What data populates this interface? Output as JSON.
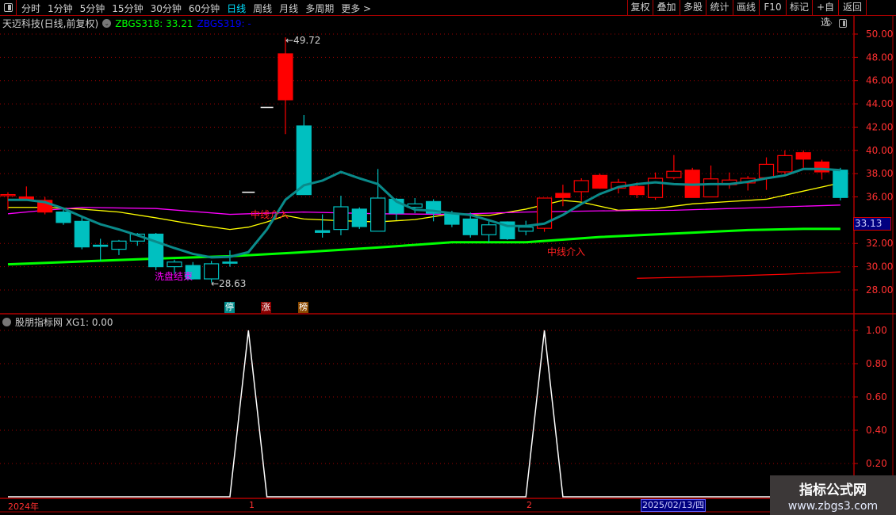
{
  "toolbar": {
    "left_items": [
      "分时",
      "1分钟",
      "5分钟",
      "15分钟",
      "30分钟",
      "60分钟",
      "日线",
      "周线",
      "月线",
      "多周期",
      "更多 >"
    ],
    "active_item": "日线",
    "right_items": [
      "复权",
      "叠加",
      "多股",
      "统计",
      "画线",
      "F10",
      "标记",
      "+自选",
      "返回"
    ]
  },
  "legend": {
    "stock_name": "天迈科技(日线,前复权)",
    "series1": "ZBGS318: 33.21",
    "series2": "ZBGS319: -"
  },
  "sub_legend": {
    "text": "股朋指标网  XG1: 0.00"
  },
  "current_price_tag": "33.13",
  "cursor_date": "2025/02/13/四",
  "annotations": {
    "high_label": "←49.72",
    "low_label": "←28.63",
    "mid_entry_1": "中线介入",
    "mid_entry_2": "中线介入",
    "washout_end": "洗盘结束"
  },
  "badges": [
    {
      "text": "停",
      "color": "#008c8c"
    },
    {
      "text": "涨",
      "color": "#8c0000"
    },
    {
      "text": "榜",
      "color": "#8c4a00"
    }
  ],
  "watermark": {
    "title": "指标公式网",
    "url": "www.zbgs3.com"
  },
  "colors": {
    "up": "#ff0000",
    "down": "#00c0c0",
    "axis": "#ff3030",
    "grid": "#b00000"
  },
  "chart_data": [
    {
      "type": "candlestick",
      "title": "天迈科技(日线,前复权)",
      "ylim": [
        27,
        50.5
      ],
      "y_ticks": [
        "50.00",
        "48.00",
        "46.00",
        "44.00",
        "42.00",
        "40.00",
        "38.00",
        "36.00",
        "32.00",
        "30.00",
        "28.00"
      ],
      "x_labels": [
        "2024年",
        "1",
        "2"
      ],
      "grid": true,
      "candles": [
        {
          "o": 36.2,
          "h": 36.4,
          "l": 34.9,
          "c": 36.2,
          "style": "red-hollow"
        },
        {
          "o": 36.0,
          "h": 36.9,
          "l": 35.9,
          "c": 35.8,
          "style": "red-solid"
        },
        {
          "o": 35.7,
          "h": 36.0,
          "l": 34.5,
          "c": 34.7,
          "style": "red-solid"
        },
        {
          "o": 34.7,
          "h": 34.9,
          "l": 33.6,
          "c": 33.8,
          "style": "cyan-solid"
        },
        {
          "o": 33.9,
          "h": 34.2,
          "l": 31.5,
          "c": 31.7,
          "style": "cyan-solid"
        },
        {
          "o": 31.85,
          "h": 32.4,
          "l": 30.5,
          "c": 31.75,
          "style": "cyan-solid"
        },
        {
          "o": 31.5,
          "h": 32.3,
          "l": 31.0,
          "c": 32.2,
          "style": "cyan-hollow"
        },
        {
          "o": 32.2,
          "h": 32.9,
          "l": 31.8,
          "c": 32.8,
          "style": "cyan-hollow"
        },
        {
          "o": 32.8,
          "h": 32.9,
          "l": 29.7,
          "c": 30.0,
          "style": "cyan-solid"
        },
        {
          "o": 30.0,
          "h": 30.6,
          "l": 29.4,
          "c": 30.4,
          "style": "cyan-hollow"
        },
        {
          "o": 30.1,
          "h": 30.4,
          "l": 28.9,
          "c": 28.95,
          "style": "cyan-solid"
        },
        {
          "o": 28.95,
          "h": 30.5,
          "l": 28.63,
          "c": 30.25,
          "style": "cyan-hollow"
        },
        {
          "o": 30.4,
          "h": 31.4,
          "l": 30.0,
          "c": 30.3,
          "style": "cyan-solid"
        },
        {
          "o": 36.4,
          "h": 36.4,
          "l": 36.4,
          "c": 36.4,
          "style": "white-dash"
        },
        {
          "o": 43.7,
          "h": 43.7,
          "l": 43.7,
          "c": 43.7,
          "style": "white-dash"
        },
        {
          "o": 48.3,
          "h": 49.72,
          "l": 41.4,
          "c": 44.35,
          "style": "red-solid"
        },
        {
          "o": 42.1,
          "h": 43.05,
          "l": 36.2,
          "c": 36.2,
          "style": "cyan-solid"
        },
        {
          "o": 33.1,
          "h": 34.5,
          "l": 32.5,
          "c": 32.95,
          "style": "cyan-solid"
        },
        {
          "o": 33.2,
          "h": 36.1,
          "l": 32.7,
          "c": 35.15,
          "style": "cyan-hollow"
        },
        {
          "o": 34.95,
          "h": 35.1,
          "l": 33.25,
          "c": 33.45,
          "style": "cyan-solid"
        },
        {
          "o": 33.05,
          "h": 38.4,
          "l": 33.05,
          "c": 35.9,
          "style": "cyan-hollow"
        },
        {
          "o": 35.8,
          "h": 35.9,
          "l": 34.0,
          "c": 34.6,
          "style": "cyan-solid"
        },
        {
          "o": 35.1,
          "h": 35.9,
          "l": 34.6,
          "c": 35.4,
          "style": "cyan-hollow"
        },
        {
          "o": 35.6,
          "h": 35.8,
          "l": 33.9,
          "c": 34.6,
          "style": "cyan-solid"
        },
        {
          "o": 34.6,
          "h": 34.8,
          "l": 33.4,
          "c": 33.65,
          "style": "cyan-solid"
        },
        {
          "o": 34.1,
          "h": 34.65,
          "l": 32.5,
          "c": 32.75,
          "style": "cyan-solid"
        },
        {
          "o": 32.75,
          "h": 33.9,
          "l": 32.1,
          "c": 33.6,
          "style": "cyan-hollow"
        },
        {
          "o": 33.85,
          "h": 33.9,
          "l": 32.3,
          "c": 32.4,
          "style": "cyan-solid"
        },
        {
          "o": 33.05,
          "h": 33.95,
          "l": 32.7,
          "c": 33.4,
          "style": "cyan-hollow"
        },
        {
          "o": 33.3,
          "h": 35.9,
          "l": 33.0,
          "c": 35.9,
          "style": "red-hollow"
        },
        {
          "o": 36.3,
          "h": 37.05,
          "l": 35.2,
          "c": 35.95,
          "style": "red-solid"
        },
        {
          "o": 36.45,
          "h": 37.6,
          "l": 35.65,
          "c": 37.4,
          "style": "red-hollow"
        },
        {
          "o": 37.85,
          "h": 38.0,
          "l": 36.7,
          "c": 36.75,
          "style": "red-solid"
        },
        {
          "o": 36.75,
          "h": 37.55,
          "l": 36.3,
          "c": 37.25,
          "style": "red-hollow"
        },
        {
          "o": 36.9,
          "h": 37.25,
          "l": 35.9,
          "c": 36.2,
          "style": "red-solid"
        },
        {
          "o": 35.95,
          "h": 38.1,
          "l": 35.75,
          "c": 37.6,
          "style": "red-hollow"
        },
        {
          "o": 37.65,
          "h": 39.6,
          "l": 37.5,
          "c": 38.2,
          "style": "red-hollow"
        },
        {
          "o": 38.3,
          "h": 38.5,
          "l": 35.95,
          "c": 35.95,
          "style": "red-solid"
        },
        {
          "o": 36.0,
          "h": 38.7,
          "l": 36.0,
          "c": 37.55,
          "style": "red-hollow"
        },
        {
          "o": 37.05,
          "h": 38.1,
          "l": 36.7,
          "c": 37.45,
          "style": "red-hollow"
        },
        {
          "o": 37.2,
          "h": 37.8,
          "l": 36.55,
          "c": 37.6,
          "style": "red-hollow"
        },
        {
          "o": 37.65,
          "h": 39.4,
          "l": 36.6,
          "c": 38.8,
          "style": "red-hollow"
        },
        {
          "o": 38.15,
          "h": 40.0,
          "l": 37.95,
          "c": 39.55,
          "style": "red-hollow"
        },
        {
          "o": 39.8,
          "h": 40.0,
          "l": 38.5,
          "c": 39.25,
          "style": "red-solid"
        },
        {
          "o": 39.0,
          "h": 39.2,
          "l": 37.5,
          "c": 38.15,
          "style": "red-solid"
        },
        {
          "o": 38.3,
          "h": 38.5,
          "l": 35.7,
          "c": 35.95,
          "style": "cyan-solid"
        }
      ],
      "lines": [
        {
          "color": "#0a8a8a",
          "width": 3,
          "values": [
            35.75,
            35.75,
            35.55,
            35.0,
            34.3,
            33.65,
            33.2,
            32.7,
            32.15,
            31.6,
            31.1,
            30.8,
            30.85,
            31.25,
            33.2,
            35.75,
            37.0,
            37.4,
            38.15,
            37.6,
            37.1,
            35.6,
            34.9,
            34.8,
            34.6,
            34.45,
            34.0,
            33.5,
            33.5,
            33.7,
            34.45,
            35.4,
            36.25,
            36.85,
            37.1,
            37.25,
            37.1,
            37.05,
            37.1,
            37.1,
            37.3,
            37.6,
            37.85,
            38.4,
            38.4,
            38.3
          ]
        },
        {
          "color": "#ffff00",
          "width": 1.3,
          "points": [
            [
              0,
              35.1
            ],
            [
              2,
              35.1
            ],
            [
              4,
              34.95
            ],
            [
              6,
              34.7
            ],
            [
              8,
              34.2
            ],
            [
              10,
              33.65
            ],
            [
              12,
              33.2
            ],
            [
              13,
              33.4
            ],
            [
              14,
              33.85
            ],
            [
              15,
              34.4
            ],
            [
              16,
              34.1
            ],
            [
              18,
              33.95
            ],
            [
              20,
              33.85
            ],
            [
              22,
              34.05
            ],
            [
              24,
              34.55
            ],
            [
              26,
              34.4
            ],
            [
              28,
              34.95
            ],
            [
              30,
              35.7
            ],
            [
              31,
              35.55
            ],
            [
              32,
              35.2
            ],
            [
              33,
              34.85
            ],
            [
              35,
              35.0
            ],
            [
              37,
              35.4
            ],
            [
              39,
              35.6
            ],
            [
              41,
              35.8
            ],
            [
              43,
              36.5
            ],
            [
              45,
              37.2
            ]
          ]
        },
        {
          "color": "#ff00ff",
          "width": 1.3,
          "points": [
            [
              0,
              34.55
            ],
            [
              2,
              34.85
            ],
            [
              4,
              35.1
            ],
            [
              8,
              35.0
            ],
            [
              12,
              34.5
            ],
            [
              16,
              34.7
            ],
            [
              20,
              34.55
            ],
            [
              24,
              34.5
            ],
            [
              28,
              34.7
            ],
            [
              32,
              34.8
            ],
            [
              36,
              34.85
            ],
            [
              40,
              35.05
            ],
            [
              45,
              35.3
            ]
          ]
        },
        {
          "color": "#00ff00",
          "width": 3,
          "points": [
            [
              0,
              30.2
            ],
            [
              4,
              30.45
            ],
            [
              8,
              30.7
            ],
            [
              12,
              30.9
            ],
            [
              16,
              31.25
            ],
            [
              20,
              31.65
            ],
            [
              24,
              32.1
            ],
            [
              28,
              32.1
            ],
            [
              32,
              32.55
            ],
            [
              36,
              32.85
            ],
            [
              40,
              33.15
            ],
            [
              43,
              33.25
            ],
            [
              45,
              33.25
            ]
          ]
        },
        {
          "color": "#ff0000",
          "width": 1.3,
          "points": [
            [
              34,
              29.0
            ],
            [
              38,
              29.15
            ],
            [
              42,
              29.35
            ],
            [
              45,
              29.55
            ]
          ]
        }
      ]
    },
    {
      "type": "line",
      "series_name": "XG1",
      "ylim": [
        0,
        1.05
      ],
      "y_ticks": [
        "1.00",
        "0.80",
        "0.60",
        "0.40",
        "0.20"
      ],
      "values": [
        0,
        0,
        0,
        0,
        0,
        0,
        0,
        0,
        0,
        0,
        0,
        0,
        0,
        1,
        0,
        0,
        0,
        0,
        0,
        0,
        0,
        0,
        0,
        0,
        0,
        0,
        0,
        0,
        0,
        1,
        0,
        0,
        0,
        0,
        0,
        0,
        0,
        0,
        0,
        0,
        0,
        0,
        0,
        0,
        0,
        0
      ],
      "color": "#ffffff"
    }
  ]
}
